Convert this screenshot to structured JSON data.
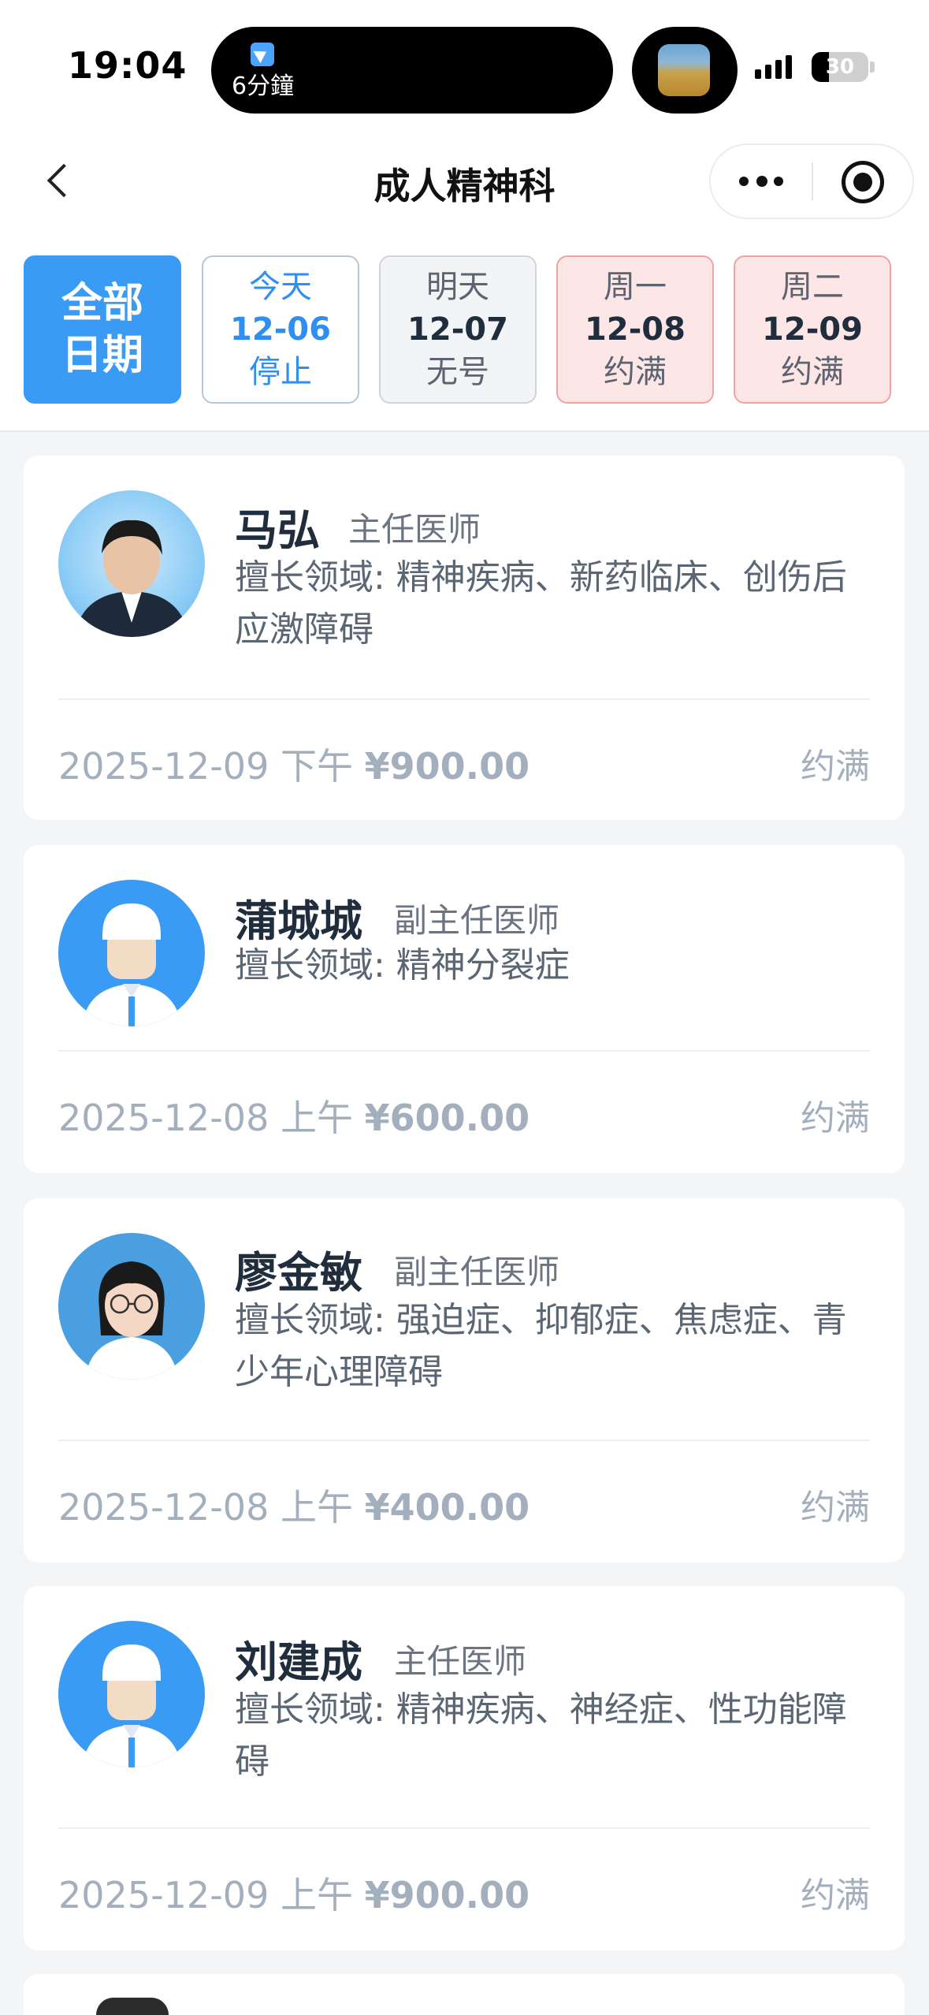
{
  "status_bar": {
    "time": "19:04",
    "live_activity": {
      "label": "6分鐘",
      "icon": "paper-plane-icon"
    },
    "battery": {
      "level": 30,
      "label": "30"
    }
  },
  "nav": {
    "title": "成人精神科",
    "back_icon": "chevron-left-icon",
    "more_icon": "more-dots-icon",
    "close_icon": "target-circle-icon"
  },
  "date_tabs": {
    "all": {
      "line1": "全部",
      "line2": "日期",
      "selected": true
    },
    "days": [
      {
        "day": "今天",
        "date": "12-06",
        "status": "停止"
      },
      {
        "day": "明天",
        "date": "12-07",
        "status": "无号"
      },
      {
        "day": "周一",
        "date": "12-08",
        "status": "约满"
      },
      {
        "day": "周二",
        "date": "12-09",
        "status": "约满"
      }
    ]
  },
  "doctors": [
    {
      "name": "马弘",
      "title": "主任医师",
      "specialty": "擅长领域: 精神疾病、新药临床、创伤后应激障碍",
      "date": "2025-12-09",
      "period": "下午",
      "price": "¥900.00",
      "status": "约满"
    },
    {
      "name": "蒲城城",
      "title": "副主任医师",
      "specialty": "擅长领域: 精神分裂症",
      "date": "2025-12-08",
      "period": "上午",
      "price": "¥600.00",
      "status": "约满"
    },
    {
      "name": "廖金敏",
      "title": "副主任医师",
      "specialty": "擅长领域: 强迫症、抑郁症、焦虑症、青少年心理障碍",
      "date": "2025-12-08",
      "period": "上午",
      "price": "¥400.00",
      "status": "约满"
    },
    {
      "name": "刘建成",
      "title": "主任医师",
      "specialty": "擅长领域: 精神疾病、神经症、性功能障碍",
      "date": "2025-12-09",
      "period": "上午",
      "price": "¥900.00",
      "status": "约满"
    }
  ],
  "colors": {
    "accent": "#3a9bf5",
    "full_bg": "#fde6e6",
    "full_border": "#f1a3a3",
    "muted_text": "#a4afbd",
    "page_bg": "#f4f5f7"
  }
}
